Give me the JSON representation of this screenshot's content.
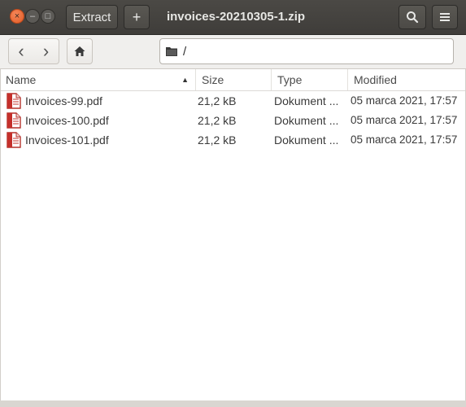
{
  "window": {
    "title": "invoices-20210305-1.zip",
    "extract_label": "Extract",
    "add_label": "+",
    "close_glyph": "×",
    "min_glyph": "–",
    "max_glyph": "□"
  },
  "toolbar": {
    "back_glyph": "‹",
    "forward_glyph": "›",
    "location_path": "/"
  },
  "columns": {
    "name": "Name",
    "size": "Size",
    "type": "Type",
    "modified": "Modified"
  },
  "files": [
    {
      "name": "Invoices-99.pdf",
      "size": "21,2 kB",
      "type": "Dokument ...",
      "modified": "05 marca 2021, 17:57"
    },
    {
      "name": "Invoices-100.pdf",
      "size": "21,2 kB",
      "type": "Dokument ...",
      "modified": "05 marca 2021, 17:57"
    },
    {
      "name": "Invoices-101.pdf",
      "size": "21,2 kB",
      "type": "Dokument ...",
      "modified": "05 marca 2021, 17:57"
    }
  ],
  "icons": {
    "search": "search-icon",
    "menu": "hamburger-menu-icon",
    "home": "home-icon",
    "folder": "folder-icon",
    "pdf": "pdf-file-icon"
  },
  "colors": {
    "headerbar": "#3f3d3a",
    "close_button": "#e05a24",
    "pdf_red": "#c4302b"
  }
}
